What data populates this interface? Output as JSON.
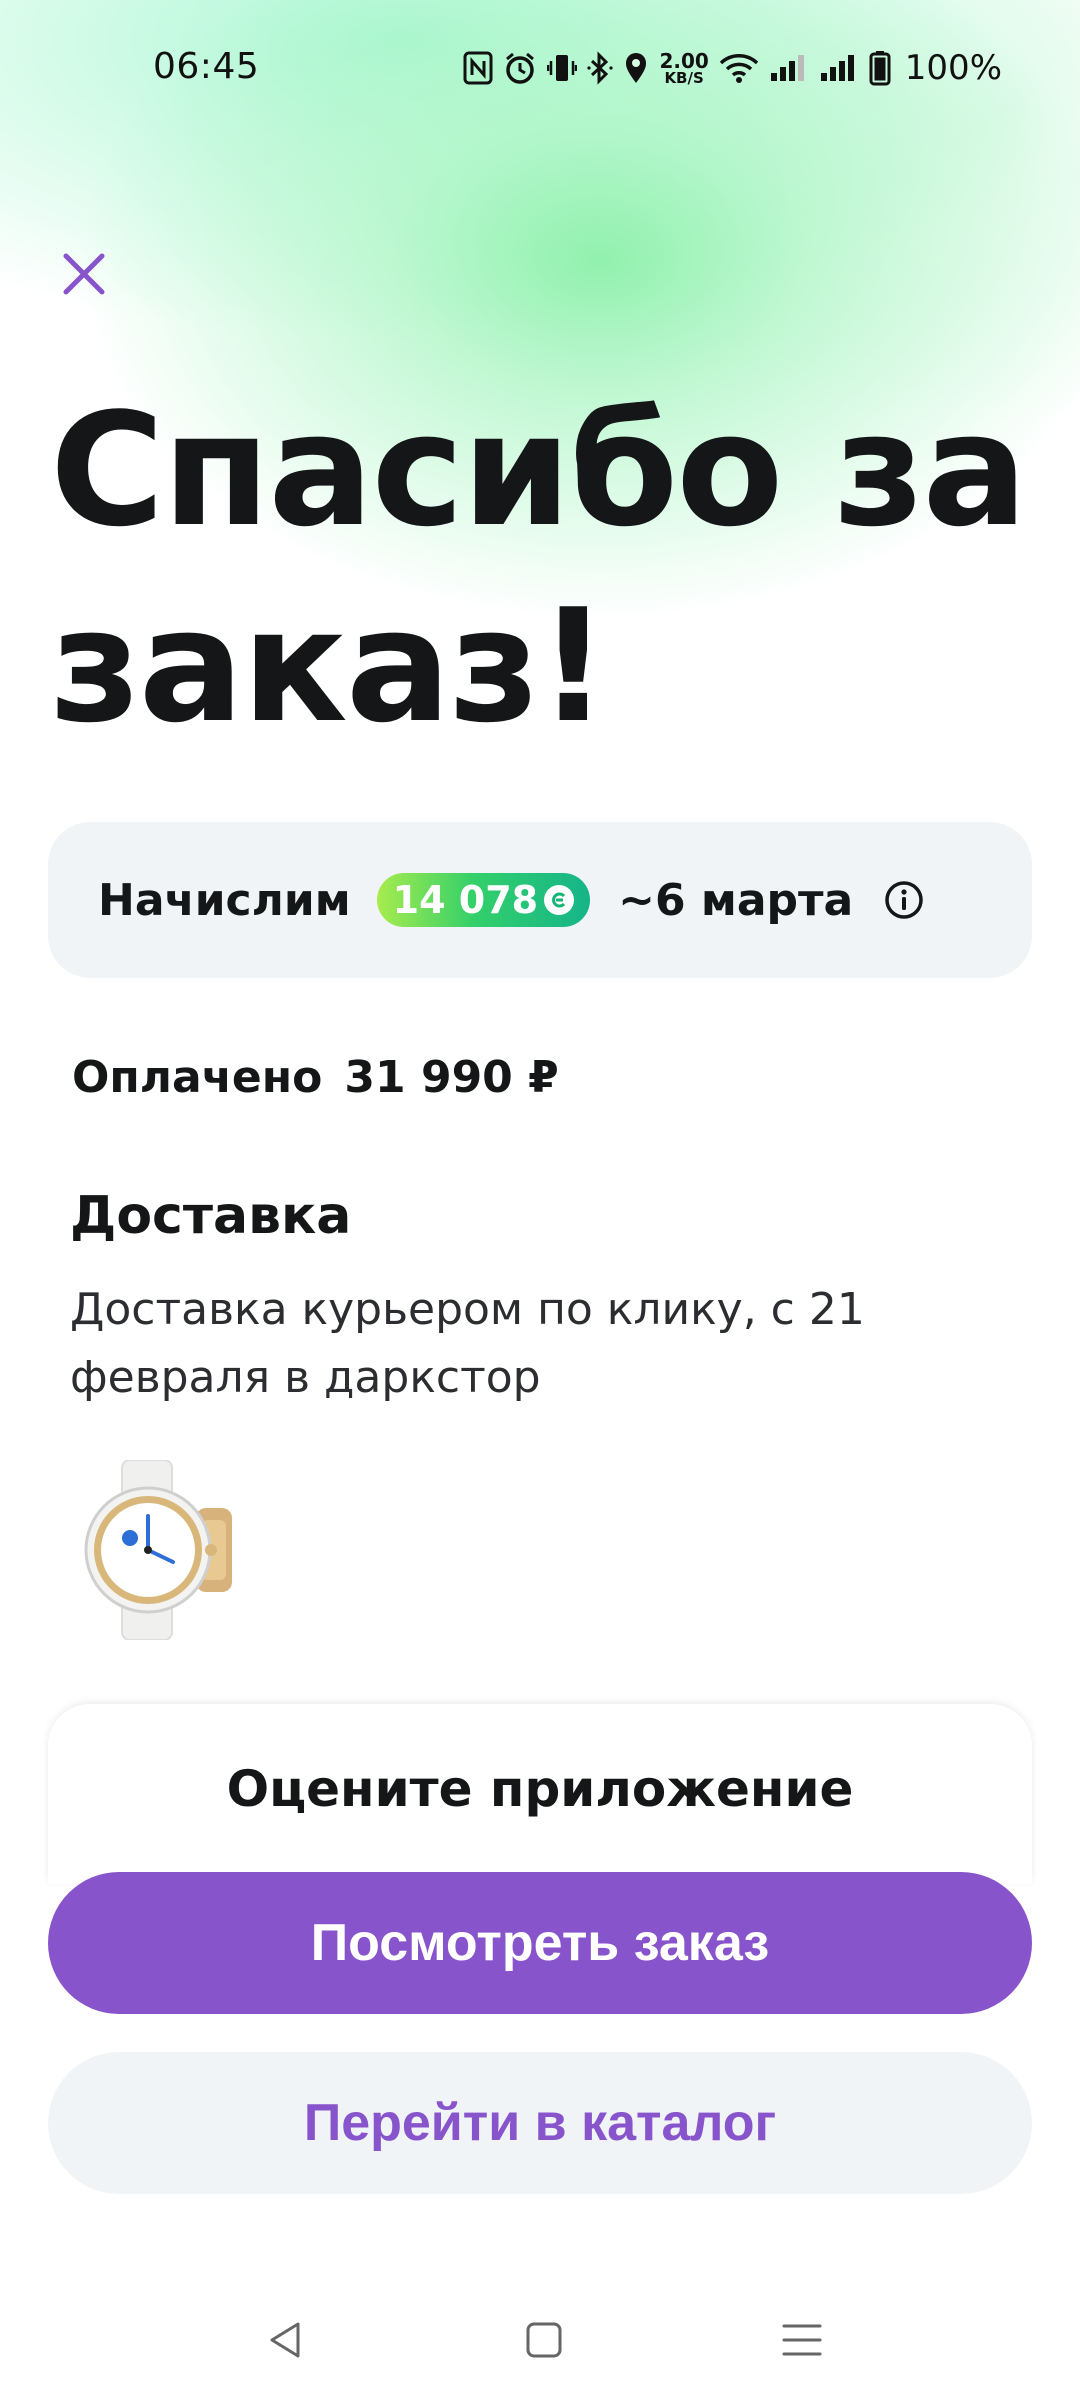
{
  "status_bar": {
    "time": "06:45",
    "net_speed_value": "2.00",
    "net_speed_unit": "KB/S",
    "battery": "100%"
  },
  "headline": "Спасибо за заказ!",
  "bonus": {
    "label": "Начислим",
    "points": "14 078",
    "date": "~6 марта"
  },
  "payment": {
    "label": "Оплачено",
    "amount": "31 990 ₽"
  },
  "delivery": {
    "title": "Доставка",
    "description": "Доставка курьером по клику, с 21 февраля в даркстор"
  },
  "rate_app": {
    "title": "Оцените приложение"
  },
  "actions": {
    "view_order": "Посмотреть заказ",
    "go_catalog": "Перейти в каталог"
  },
  "colors": {
    "accent": "#8754cc",
    "card_bg": "#f1f4f7",
    "badge_gradient_start": "#a8ec4d",
    "badge_gradient_end": "#15b489"
  },
  "icons": {
    "close": "close-icon",
    "info": "info-icon",
    "nav_back": "back-triangle-icon",
    "nav_home": "home-square-icon",
    "nav_menu": "menu-lines-icon"
  }
}
